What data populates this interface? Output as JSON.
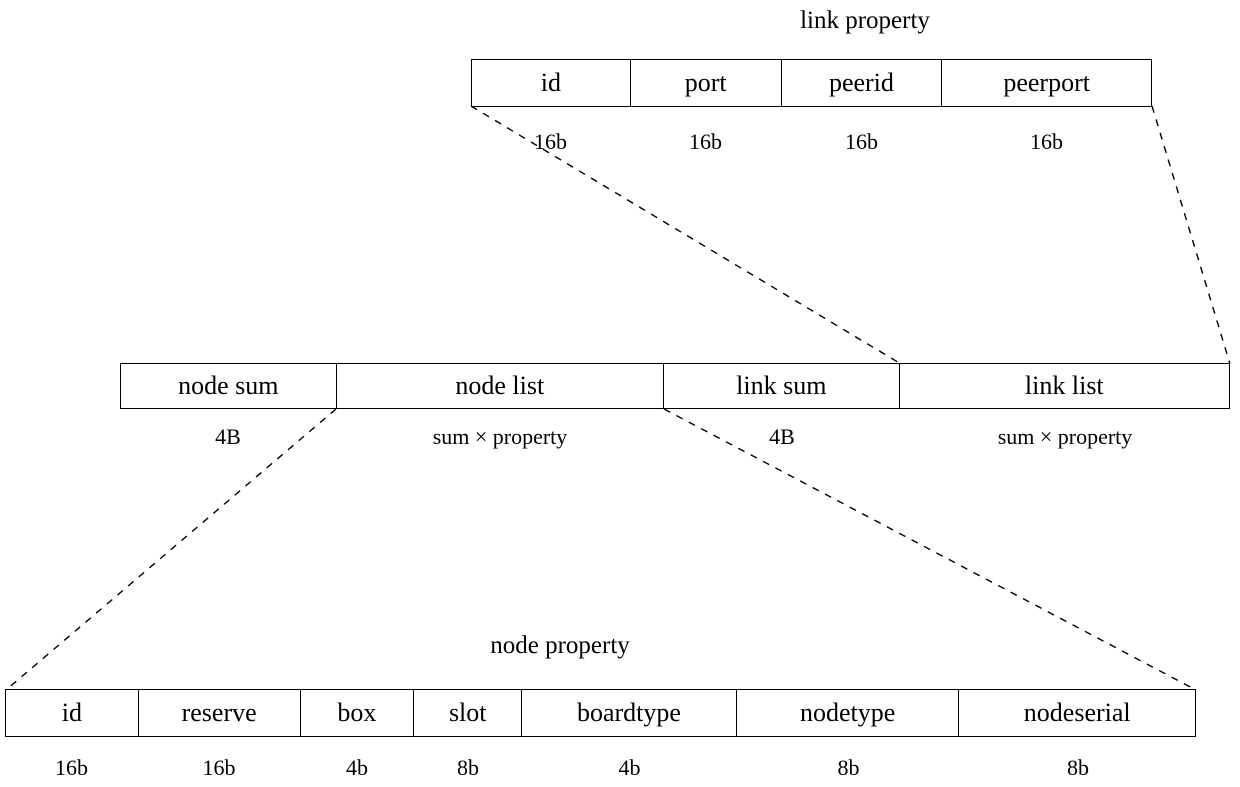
{
  "diagram": {
    "title_link": "link property",
    "title_node": "node property",
    "link_property": {
      "fields": [
        {
          "name": "id",
          "size": "16b"
        },
        {
          "name": "port",
          "size": "16b"
        },
        {
          "name": "peerid",
          "size": "16b"
        },
        {
          "name": "peerport",
          "size": "16b"
        }
      ]
    },
    "packet": {
      "fields": [
        {
          "name": "node sum",
          "size": "4B"
        },
        {
          "name": "node list",
          "size": "sum × property"
        },
        {
          "name": "link sum",
          "size": "4B"
        },
        {
          "name": "link list",
          "size": "sum × property"
        }
      ]
    },
    "node_property": {
      "fields": [
        {
          "name": "id",
          "size": "16b"
        },
        {
          "name": "reserve",
          "size": "16b"
        },
        {
          "name": "box",
          "size": "4b"
        },
        {
          "name": "slot",
          "size": "8b"
        },
        {
          "name": "boardtype",
          "size": "4b"
        },
        {
          "name": "nodetype",
          "size": "8b"
        },
        {
          "name": "nodeserial",
          "size": "8b"
        }
      ]
    },
    "colors": {
      "stroke": "#000000",
      "background": "#ffffff",
      "text": "#000000"
    }
  }
}
